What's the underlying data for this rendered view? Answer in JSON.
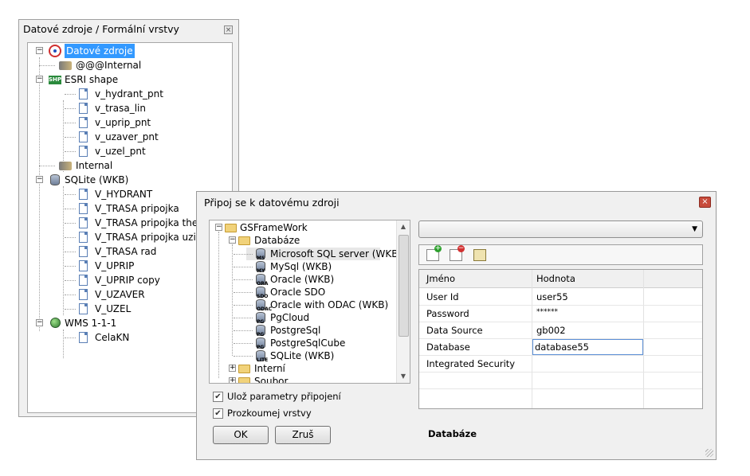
{
  "left_panel": {
    "title": "Datové zdroje / Formální vrstvy",
    "close": "×",
    "tree": {
      "root": "Datové zdroje",
      "internal_at": "@@@Internal",
      "esri": "ESRI shape",
      "esri_items": [
        "v_hydrant_pnt",
        "v_trasa_lin",
        "v_uprip_pnt",
        "v_uzaver_pnt",
        "v_uzel_pnt"
      ],
      "internal": "Internal",
      "sqlite": "SQLite (WKB)",
      "sqlite_items": [
        "V_HYDRANT",
        "V_TRASA pripojka",
        "V_TRASA pripojka thema",
        "V_TRASA pripojka uziv",
        "V_TRASA rad",
        "V_UPRIP",
        "V_UPRIP copy",
        "V_UZAVER",
        "V_UZEL"
      ],
      "wms": "WMS 1-1-1",
      "wms_items": [
        "CelaKN"
      ]
    }
  },
  "dialog": {
    "title": "Připoj se k datovému zdroji",
    "close": "×",
    "tree": {
      "root": "GSFrameWork",
      "databaze": "Databáze",
      "providers": [
        "Microsoft SQL server (WKB)",
        "MySql (WKB)",
        "Oracle (WKB)",
        "Oracle SDO",
        "Oracle with ODAC (WKB)",
        "PgCloud",
        "PostgreSql",
        "PostgreSqlCube",
        "SQLite (WKB)"
      ],
      "provider_tags": [
        "MS",
        "MY",
        "ORA",
        "SDO",
        "ODAC",
        "PG",
        "PG",
        "PG",
        "LITE"
      ],
      "interni": "Interní",
      "soubor": "Soubor"
    },
    "save_params_label": "Ulož parametry připojení",
    "save_params_checked": true,
    "explore_layers_label": "Prozkoumej vrstvy",
    "explore_layers_checked": true,
    "ok_label": "OK",
    "cancel_label": "Zruš",
    "combo_value": "",
    "grid": {
      "col_name": "Jméno",
      "col_value": "Hodnota",
      "rows": [
        {
          "name": "User Id",
          "value": "user55"
        },
        {
          "name": "Password",
          "value": "******"
        },
        {
          "name": "Data Source",
          "value": "gb002"
        },
        {
          "name": "Database",
          "value": "database55"
        },
        {
          "name": "Integrated Security",
          "value": ""
        }
      ]
    },
    "status": "Databáze"
  }
}
